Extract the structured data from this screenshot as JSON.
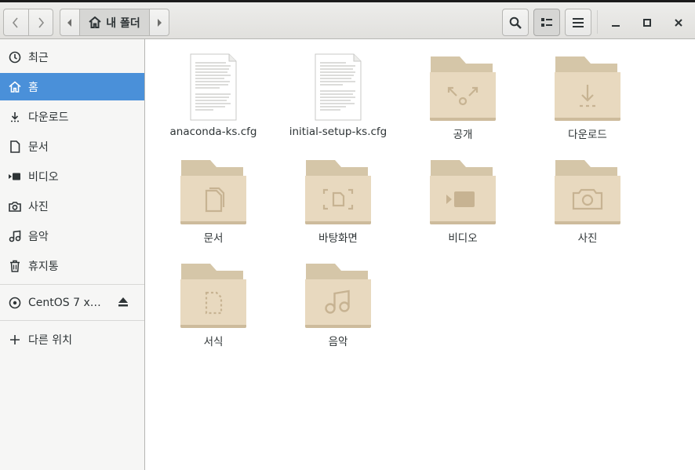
{
  "header": {
    "path_label": "내 폴더",
    "buttons": [
      "back",
      "forward",
      "path-prev",
      "path-next",
      "search",
      "view-toggle",
      "menu",
      "minimize",
      "maximize",
      "close"
    ]
  },
  "sidebar": {
    "items": [
      {
        "label": "최근",
        "icon": "clock-icon"
      },
      {
        "label": "홈",
        "icon": "home-icon",
        "active": true
      },
      {
        "label": "다운로드",
        "icon": "download-icon"
      },
      {
        "label": "문서",
        "icon": "document-icon"
      },
      {
        "label": "비디오",
        "icon": "video-icon"
      },
      {
        "label": "사진",
        "icon": "camera-icon"
      },
      {
        "label": "음악",
        "icon": "music-icon"
      },
      {
        "label": "휴지통",
        "icon": "trash-icon"
      }
    ],
    "device": {
      "label": "CentOS 7 x…",
      "icon": "disc-icon",
      "action_icon": "eject-icon"
    },
    "other": {
      "label": "다른 위치",
      "icon": "plus-icon"
    }
  },
  "files": [
    {
      "name": "anaconda-ks.cfg",
      "type": "text-file"
    },
    {
      "name": "initial-setup-ks.cfg",
      "type": "text-file"
    },
    {
      "name": "공개",
      "type": "folder",
      "emblem": "share-icon"
    },
    {
      "name": "다운로드",
      "type": "folder",
      "emblem": "download-icon"
    },
    {
      "name": "문서",
      "type": "folder",
      "emblem": "document-icon"
    },
    {
      "name": "바탕화면",
      "type": "folder",
      "emblem": "desktop-icon"
    },
    {
      "name": "비디오",
      "type": "folder",
      "emblem": "video-icon"
    },
    {
      "name": "사진",
      "type": "folder",
      "emblem": "camera-icon"
    },
    {
      "name": "서식",
      "type": "folder",
      "emblem": "template-icon"
    },
    {
      "name": "음악",
      "type": "folder",
      "emblem": "music-icon"
    }
  ],
  "colors": {
    "accent": "#4a90d9",
    "folder": "#e8d9bf",
    "folder_tab": "#d5c6a8",
    "emblem": "#c7b392"
  }
}
